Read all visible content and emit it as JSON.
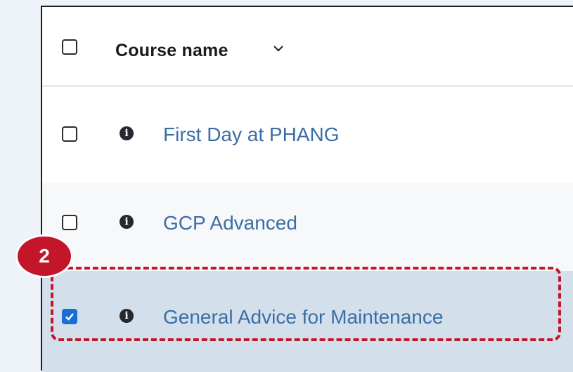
{
  "table": {
    "header": {
      "column_label": "Course name",
      "sort_icon": "chevron-down-icon",
      "select_all_checked": false
    },
    "rows": [
      {
        "name": "First Day at PHANG",
        "checked": false,
        "icon": "info-icon"
      },
      {
        "name": "GCP Advanced",
        "checked": false,
        "icon": "info-icon"
      },
      {
        "name": "General Advice for Maintenance",
        "checked": true,
        "icon": "info-icon"
      }
    ]
  },
  "annotation": {
    "step_number": "2",
    "color": "#c4162a"
  },
  "colors": {
    "link": "#3a6ea5",
    "selected_row_bg": "#d3e0ec",
    "checkbox_checked": "#1a6fd6"
  }
}
